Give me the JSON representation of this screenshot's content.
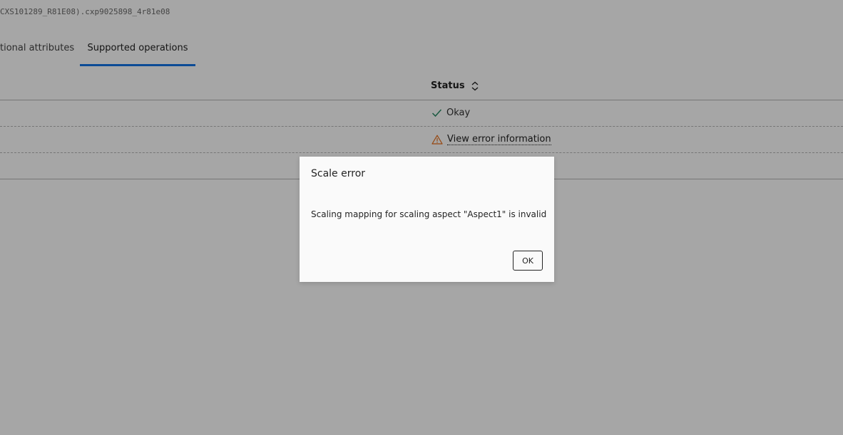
{
  "breadcrumb": {
    "text": "CXS101289_R81E08).cxp9025898_4r81e08"
  },
  "tabs": [
    {
      "label": "tional attributes",
      "active": false
    },
    {
      "label": "Supported operations",
      "active": true
    }
  ],
  "table": {
    "columns": {
      "status": "Status"
    },
    "rows": [
      {
        "status": "Okay",
        "status_icon": "checkmark-icon",
        "type": "ok"
      },
      {
        "status": "View error information",
        "status_icon": "warning-triangle-icon",
        "type": "error"
      },
      {
        "status": "",
        "type": "empty"
      }
    ]
  },
  "dialog": {
    "title": "Scale error",
    "message": "Scaling mapping for scaling aspect \"Aspect1\" is invalid",
    "ok_label": "OK"
  },
  "colors": {
    "accent": "#1174e6",
    "success": "#288964",
    "warning": "#e66e19",
    "overlay": "rgba(0,0,0,0.35)"
  }
}
